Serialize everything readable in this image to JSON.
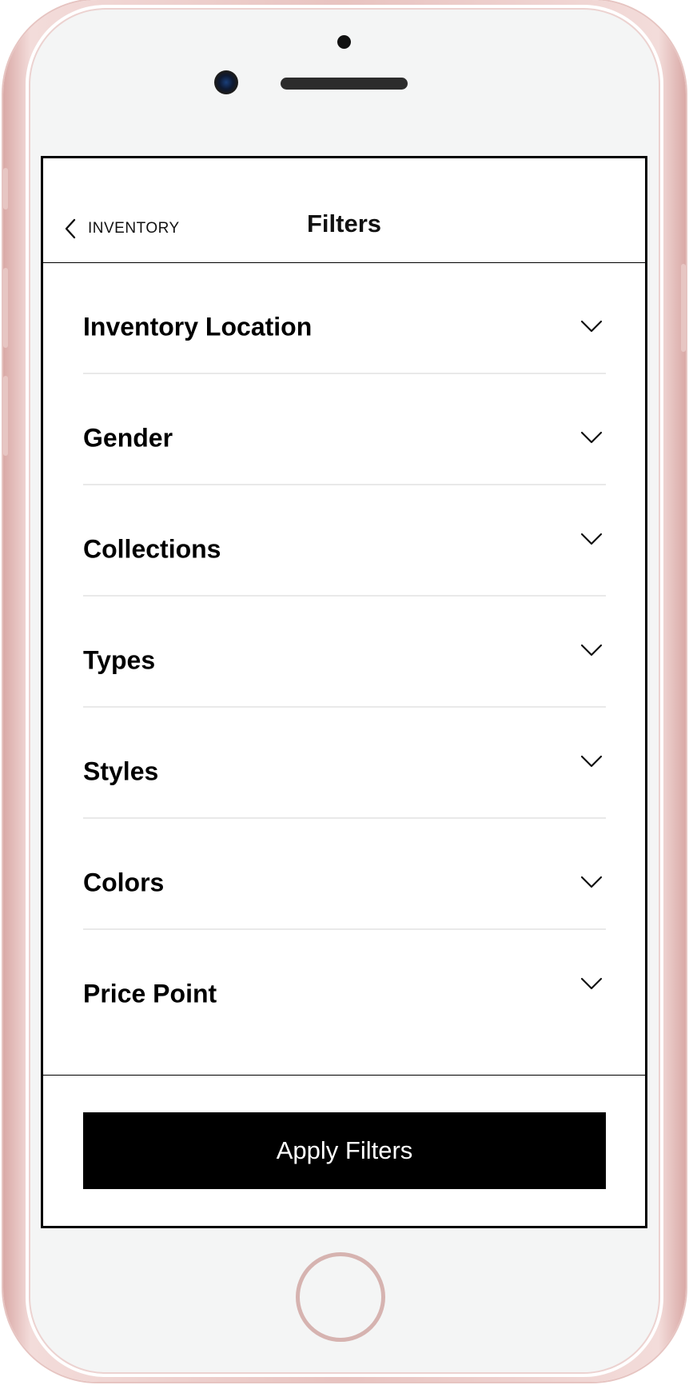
{
  "header": {
    "back_label": "INVENTORY",
    "title": "Filters",
    "back_icon": "chevron-left-icon"
  },
  "filters": [
    {
      "label": "Inventory Location",
      "icon": "chevron-down-icon"
    },
    {
      "label": "Gender",
      "icon": "chevron-down-icon"
    },
    {
      "label": "Collections",
      "icon": "chevron-down-icon"
    },
    {
      "label": "Types",
      "icon": "chevron-down-icon"
    },
    {
      "label": "Styles",
      "icon": "chevron-down-icon"
    },
    {
      "label": "Colors",
      "icon": "chevron-down-icon"
    },
    {
      "label": "Price Point",
      "icon": "chevron-down-icon"
    }
  ],
  "footer": {
    "apply_label": "Apply Filters"
  },
  "colors": {
    "text": "#000000",
    "button_bg": "#000000",
    "button_text": "#ffffff",
    "divider": "#e9e9e9",
    "device_frame": "#e8c3c0"
  }
}
